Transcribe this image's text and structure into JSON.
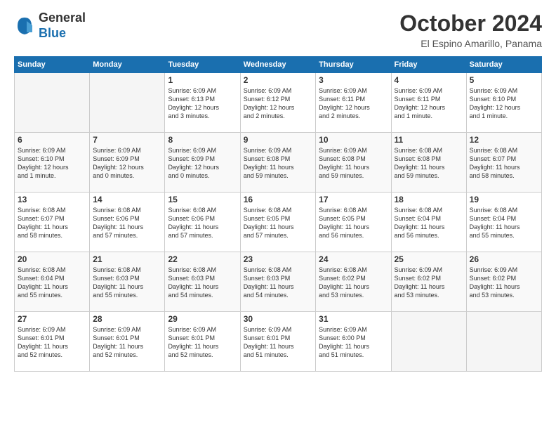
{
  "header": {
    "logo_general": "General",
    "logo_blue": "Blue",
    "month_title": "October 2024",
    "location": "El Espino Amarillo, Panama"
  },
  "weekdays": [
    "Sunday",
    "Monday",
    "Tuesday",
    "Wednesday",
    "Thursday",
    "Friday",
    "Saturday"
  ],
  "weeks": [
    [
      {
        "day": "",
        "empty": true
      },
      {
        "day": "",
        "empty": true
      },
      {
        "day": "1",
        "info": "Sunrise: 6:09 AM\nSunset: 6:13 PM\nDaylight: 12 hours\nand 3 minutes."
      },
      {
        "day": "2",
        "info": "Sunrise: 6:09 AM\nSunset: 6:12 PM\nDaylight: 12 hours\nand 2 minutes."
      },
      {
        "day": "3",
        "info": "Sunrise: 6:09 AM\nSunset: 6:11 PM\nDaylight: 12 hours\nand 2 minutes."
      },
      {
        "day": "4",
        "info": "Sunrise: 6:09 AM\nSunset: 6:11 PM\nDaylight: 12 hours\nand 1 minute."
      },
      {
        "day": "5",
        "info": "Sunrise: 6:09 AM\nSunset: 6:10 PM\nDaylight: 12 hours\nand 1 minute."
      }
    ],
    [
      {
        "day": "6",
        "info": "Sunrise: 6:09 AM\nSunset: 6:10 PM\nDaylight: 12 hours\nand 1 minute."
      },
      {
        "day": "7",
        "info": "Sunrise: 6:09 AM\nSunset: 6:09 PM\nDaylight: 12 hours\nand 0 minutes."
      },
      {
        "day": "8",
        "info": "Sunrise: 6:09 AM\nSunset: 6:09 PM\nDaylight: 12 hours\nand 0 minutes."
      },
      {
        "day": "9",
        "info": "Sunrise: 6:09 AM\nSunset: 6:08 PM\nDaylight: 11 hours\nand 59 minutes."
      },
      {
        "day": "10",
        "info": "Sunrise: 6:09 AM\nSunset: 6:08 PM\nDaylight: 11 hours\nand 59 minutes."
      },
      {
        "day": "11",
        "info": "Sunrise: 6:08 AM\nSunset: 6:08 PM\nDaylight: 11 hours\nand 59 minutes."
      },
      {
        "day": "12",
        "info": "Sunrise: 6:08 AM\nSunset: 6:07 PM\nDaylight: 11 hours\nand 58 minutes."
      }
    ],
    [
      {
        "day": "13",
        "info": "Sunrise: 6:08 AM\nSunset: 6:07 PM\nDaylight: 11 hours\nand 58 minutes."
      },
      {
        "day": "14",
        "info": "Sunrise: 6:08 AM\nSunset: 6:06 PM\nDaylight: 11 hours\nand 57 minutes."
      },
      {
        "day": "15",
        "info": "Sunrise: 6:08 AM\nSunset: 6:06 PM\nDaylight: 11 hours\nand 57 minutes."
      },
      {
        "day": "16",
        "info": "Sunrise: 6:08 AM\nSunset: 6:05 PM\nDaylight: 11 hours\nand 57 minutes."
      },
      {
        "day": "17",
        "info": "Sunrise: 6:08 AM\nSunset: 6:05 PM\nDaylight: 11 hours\nand 56 minutes."
      },
      {
        "day": "18",
        "info": "Sunrise: 6:08 AM\nSunset: 6:04 PM\nDaylight: 11 hours\nand 56 minutes."
      },
      {
        "day": "19",
        "info": "Sunrise: 6:08 AM\nSunset: 6:04 PM\nDaylight: 11 hours\nand 55 minutes."
      }
    ],
    [
      {
        "day": "20",
        "info": "Sunrise: 6:08 AM\nSunset: 6:04 PM\nDaylight: 11 hours\nand 55 minutes."
      },
      {
        "day": "21",
        "info": "Sunrise: 6:08 AM\nSunset: 6:03 PM\nDaylight: 11 hours\nand 55 minutes."
      },
      {
        "day": "22",
        "info": "Sunrise: 6:08 AM\nSunset: 6:03 PM\nDaylight: 11 hours\nand 54 minutes."
      },
      {
        "day": "23",
        "info": "Sunrise: 6:08 AM\nSunset: 6:03 PM\nDaylight: 11 hours\nand 54 minutes."
      },
      {
        "day": "24",
        "info": "Sunrise: 6:08 AM\nSunset: 6:02 PM\nDaylight: 11 hours\nand 53 minutes."
      },
      {
        "day": "25",
        "info": "Sunrise: 6:09 AM\nSunset: 6:02 PM\nDaylight: 11 hours\nand 53 minutes."
      },
      {
        "day": "26",
        "info": "Sunrise: 6:09 AM\nSunset: 6:02 PM\nDaylight: 11 hours\nand 53 minutes."
      }
    ],
    [
      {
        "day": "27",
        "info": "Sunrise: 6:09 AM\nSunset: 6:01 PM\nDaylight: 11 hours\nand 52 minutes."
      },
      {
        "day": "28",
        "info": "Sunrise: 6:09 AM\nSunset: 6:01 PM\nDaylight: 11 hours\nand 52 minutes."
      },
      {
        "day": "29",
        "info": "Sunrise: 6:09 AM\nSunset: 6:01 PM\nDaylight: 11 hours\nand 52 minutes."
      },
      {
        "day": "30",
        "info": "Sunrise: 6:09 AM\nSunset: 6:01 PM\nDaylight: 11 hours\nand 51 minutes."
      },
      {
        "day": "31",
        "info": "Sunrise: 6:09 AM\nSunset: 6:00 PM\nDaylight: 11 hours\nand 51 minutes."
      },
      {
        "day": "",
        "empty": true
      },
      {
        "day": "",
        "empty": true
      }
    ]
  ]
}
